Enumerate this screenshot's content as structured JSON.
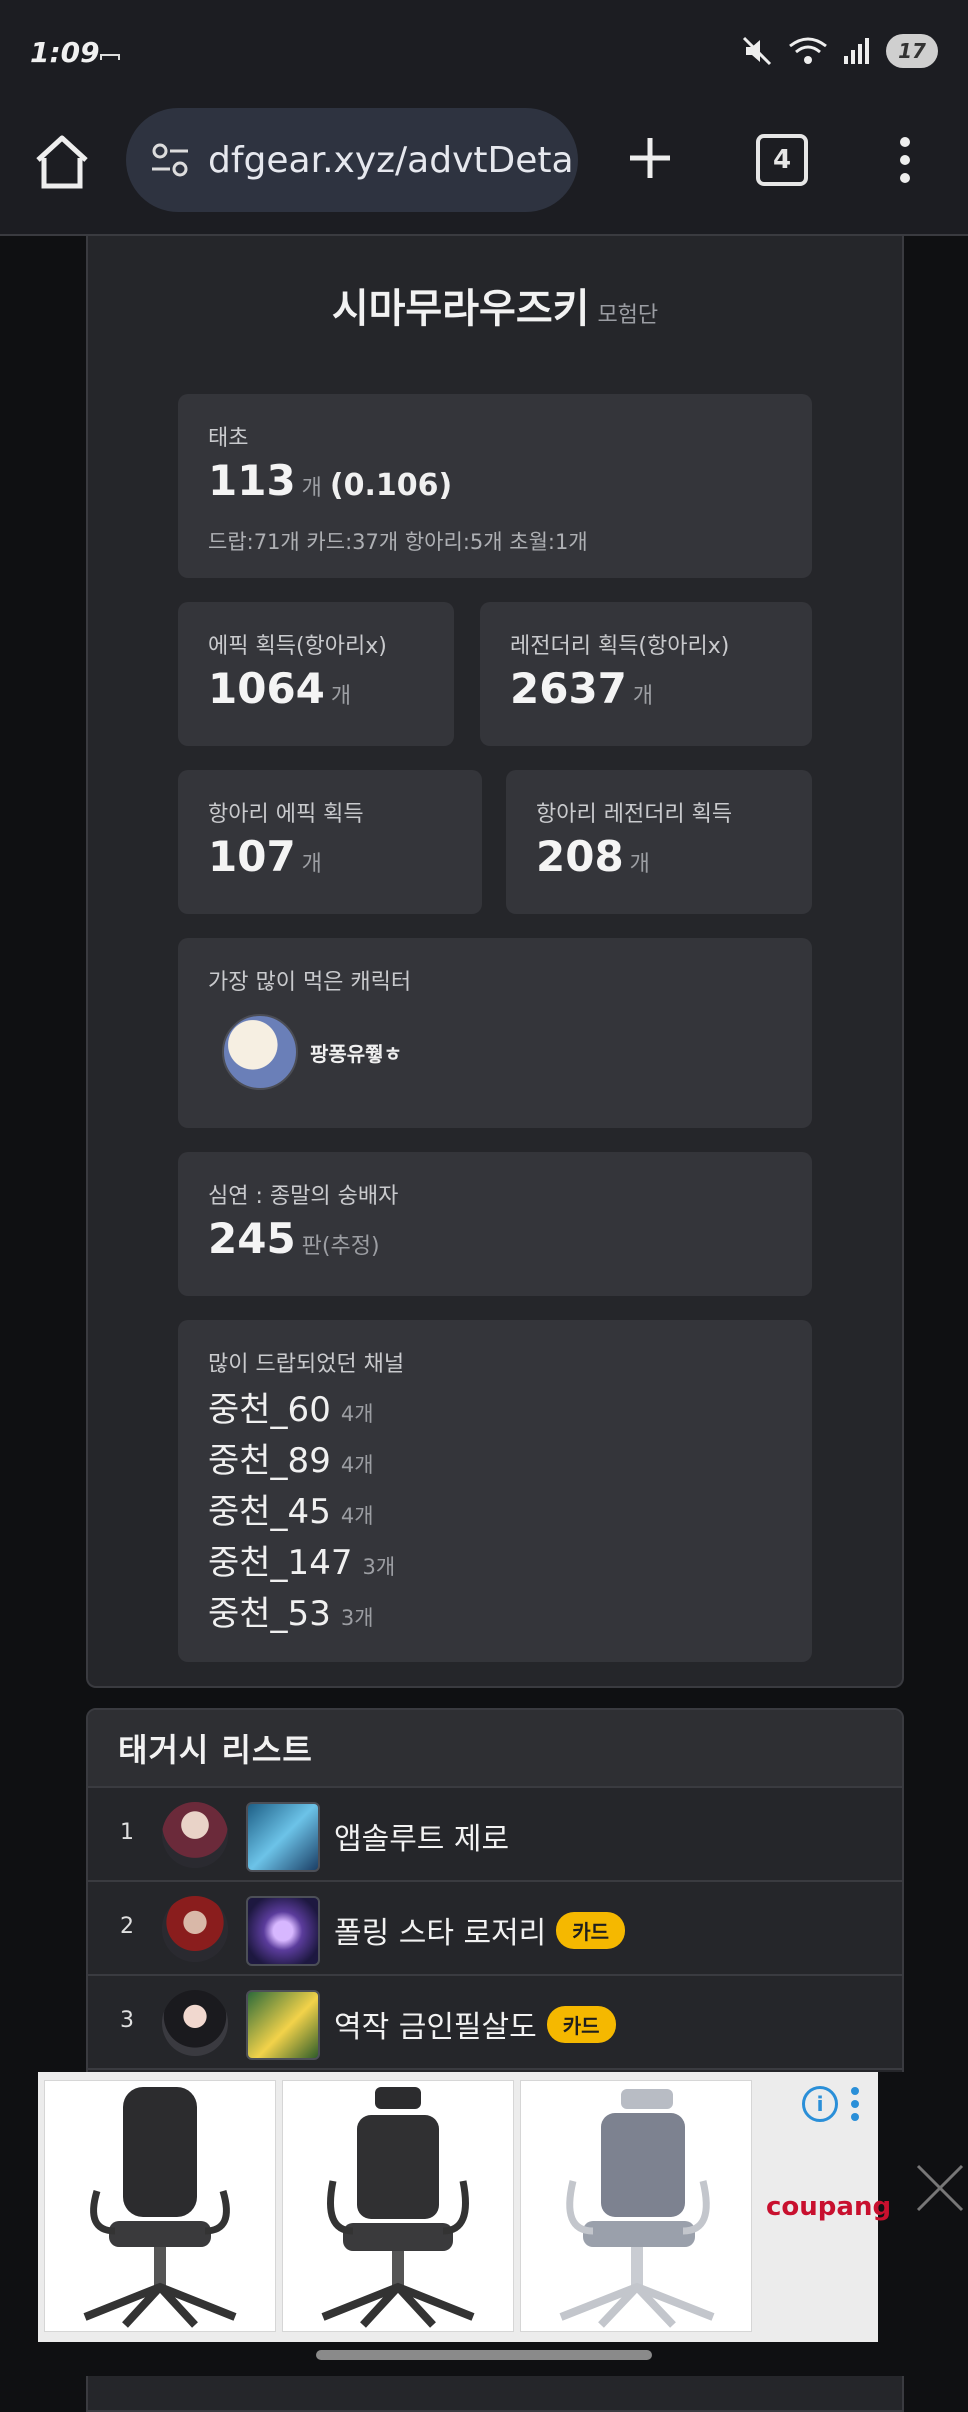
{
  "status": {
    "time": "1:09",
    "battery": "17"
  },
  "browser": {
    "url": "dfgear.xyz/advtDeta",
    "tab_count": "4"
  },
  "adventure": {
    "name": "시마무라우즈키",
    "subtitle": "모험단"
  },
  "taecho": {
    "label": "태초",
    "count": "113",
    "unit": "개",
    "rate": "(0.106)",
    "breakdown": "드랍:71개 카드:37개 항아리:5개 초월:1개"
  },
  "stats": [
    {
      "label": "에픽 획득(항아리x)",
      "value": "1064",
      "unit": "개"
    },
    {
      "label": "레전더리 획득(항아리x)",
      "value": "2637",
      "unit": "개"
    },
    {
      "label": "항아리 에픽 획득",
      "value": "107",
      "unit": "개"
    },
    {
      "label": "항아리 레전더리 획득",
      "value": "208",
      "unit": "개"
    }
  ],
  "top_character": {
    "label": "가장 많이 먹은 캐릭터",
    "name": "팡퐁유쭿ㅎ"
  },
  "abyss": {
    "label": "심연 : 종말의 숭배자",
    "value": "245",
    "unit": "판(추정)"
  },
  "channels": {
    "label": "많이 드랍되었던 채널",
    "items": [
      {
        "name": "중천_60",
        "count": "4개"
      },
      {
        "name": "중천_89",
        "count": "4개"
      },
      {
        "name": "중천_45",
        "count": "4개"
      },
      {
        "name": "중천_147",
        "count": "3개"
      },
      {
        "name": "중천_53",
        "count": "3개"
      }
    ]
  },
  "taegeosi": {
    "title": "태거시 리스트",
    "rows": [
      {
        "rank": "1",
        "name": "앱솔루트 제로",
        "badge": ""
      },
      {
        "rank": "2",
        "name": "폴링 스타 로저리",
        "badge": "카드"
      },
      {
        "rank": "3",
        "name": "역작 금인필살도",
        "badge": "카드"
      }
    ]
  },
  "ad": {
    "brand": "coupang",
    "info": "i"
  },
  "colors": {
    "badge": "#f5b800",
    "card_bg": "#25262a",
    "box_bg": "#34353a",
    "url_pill": "#2e3340"
  }
}
